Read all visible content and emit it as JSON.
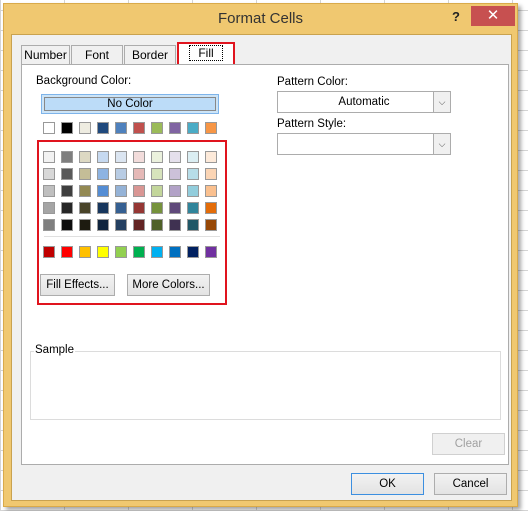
{
  "window": {
    "title": "Format Cells",
    "help": "?",
    "close": "✕"
  },
  "tabs": [
    {
      "label": "Number"
    },
    {
      "label": "Font"
    },
    {
      "label": "Border"
    },
    {
      "label": "Fill",
      "active": true
    }
  ],
  "fill": {
    "background_color_label": "Background Color:",
    "no_color": "No Color",
    "theme_colors": [
      "#FFFFFF",
      "#000000",
      "#EEECE1",
      "#1F497D",
      "#4F81BD",
      "#C0504D",
      "#9BBB59",
      "#8064A2",
      "#4BACC6",
      "#F79646"
    ],
    "shades": [
      [
        "#F2F2F2",
        "#7F7F7F",
        "#DDD9C3",
        "#C6D9F0",
        "#DBE5F1",
        "#F2DCDB",
        "#EBF1DD",
        "#E5E0EC",
        "#DBEEF3",
        "#FDEADA"
      ],
      [
        "#D8D8D8",
        "#595959",
        "#C4BD97",
        "#8DB3E2",
        "#B8CCE4",
        "#E5B9B7",
        "#D7E3BC",
        "#CCC1D9",
        "#B7DDE8",
        "#FBD5B5"
      ],
      [
        "#BFBFBF",
        "#3F3F3F",
        "#938953",
        "#548DD4",
        "#95B3D7",
        "#D99694",
        "#C3D69B",
        "#B2A2C7",
        "#92CDDC",
        "#FAC08F"
      ],
      [
        "#A5A5A5",
        "#262626",
        "#494429",
        "#17365D",
        "#366092",
        "#953734",
        "#76923C",
        "#5F497A",
        "#31859B",
        "#E36C09"
      ],
      [
        "#7F7F7F",
        "#0C0C0C",
        "#1D1B10",
        "#0F243E",
        "#244061",
        "#632423",
        "#4F6128",
        "#3F3151",
        "#205867",
        "#974806"
      ]
    ],
    "standard_colors": [
      "#C00000",
      "#FF0000",
      "#FFC000",
      "#FFFF00",
      "#92D050",
      "#00B050",
      "#00B0F0",
      "#0070C0",
      "#002060",
      "#7030A0"
    ],
    "fill_effects": "Fill Effects...",
    "more_colors": "More Colors...",
    "pattern_color_label": "Pattern Color:",
    "pattern_color_value": "Automatic",
    "pattern_style_label": "Pattern Style:",
    "pattern_style_value": "",
    "sample_label": "Sample",
    "clear": "Clear"
  },
  "footer": {
    "ok": "OK",
    "cancel": "Cancel"
  },
  "highlight_color": "#E0141E"
}
